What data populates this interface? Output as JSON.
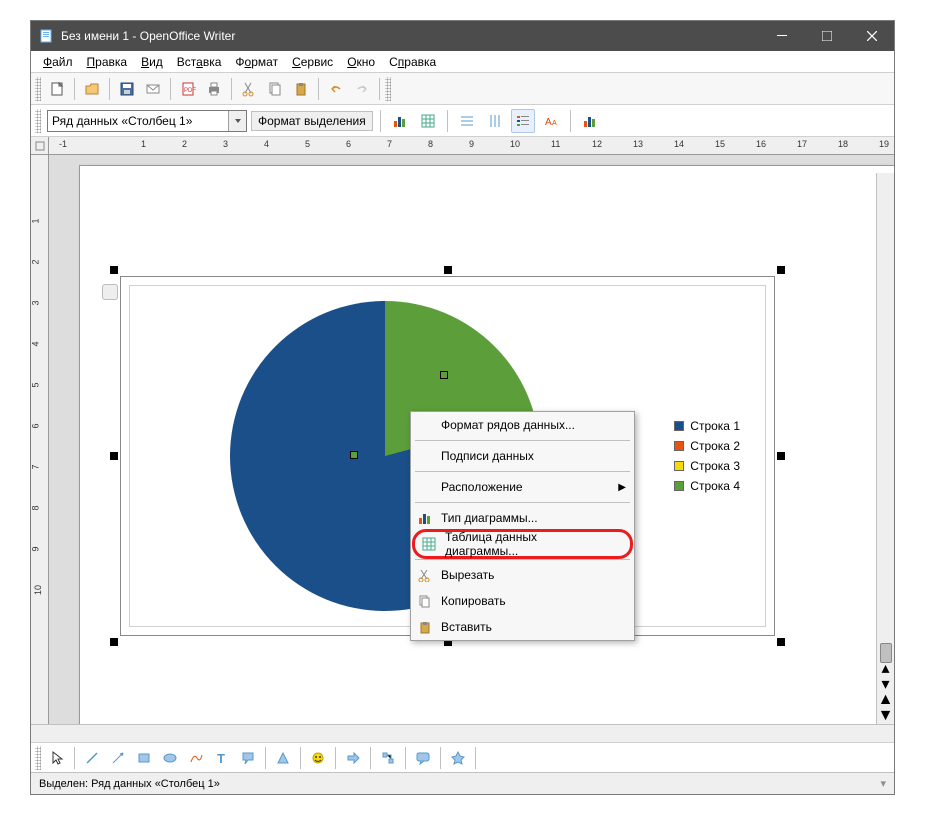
{
  "titlebar": {
    "text": "Без имени 1 - OpenOffice Writer"
  },
  "menubar": [
    {
      "label": "Файл",
      "u": 0
    },
    {
      "label": "Правка",
      "u": 0
    },
    {
      "label": "Вид",
      "u": 0
    },
    {
      "label": "Вставка",
      "u": 3
    },
    {
      "label": "Формат",
      "u": 1
    },
    {
      "label": "Сервис",
      "u": 0
    },
    {
      "label": "Окно",
      "u": 0
    },
    {
      "label": "Справка",
      "u": 1
    }
  ],
  "combo": {
    "value": "Ряд данных «Столбец 1»"
  },
  "format_label": "Формат выделения",
  "ruler_h": [
    "-1",
    "",
    "1",
    "2",
    "3",
    "4",
    "5",
    "6",
    "7",
    "8",
    "9",
    "10",
    "11",
    "12",
    "13",
    "14",
    "15",
    "16",
    "17",
    "18",
    "19"
  ],
  "ruler_v": [
    "",
    "1",
    "2",
    "3",
    "4",
    "5",
    "6",
    "7",
    "8",
    "9",
    "10"
  ],
  "legend": [
    {
      "label": "Строка 1",
      "color": "#1b4f8a"
    },
    {
      "label": "Строка 2",
      "color": "#e8530e"
    },
    {
      "label": "Строка 3",
      "color": "#f5d908"
    },
    {
      "label": "Строка 4",
      "color": "#5c9f3a"
    }
  ],
  "context_menu": {
    "format_rows": "Формат рядов данных...",
    "data_labels": "Подписи данных",
    "position": "Расположение",
    "chart_type": "Тип диаграммы...",
    "data_table": "Таблица данных диаграммы...",
    "cut": "Вырезать",
    "copy": "Копировать",
    "paste": "Вставить"
  },
  "statusbar": {
    "text": "Выделен: Ряд данных «Столбец 1»"
  },
  "chart_data": {
    "type": "pie",
    "title": "",
    "categories": [
      "Строка 1",
      "Строка 2",
      "Строка 3",
      "Строка 4"
    ],
    "series": [
      {
        "name": "Столбец 1",
        "values": [
          79,
          0,
          0,
          21
        ]
      }
    ],
    "colors": [
      "#1b4f8a",
      "#e8530e",
      "#f5d908",
      "#5c9f3a"
    ],
    "note": "Only blue (≈79%) and green (≈21%) slices visible; orange and yellow slices are 0 or negligible."
  }
}
